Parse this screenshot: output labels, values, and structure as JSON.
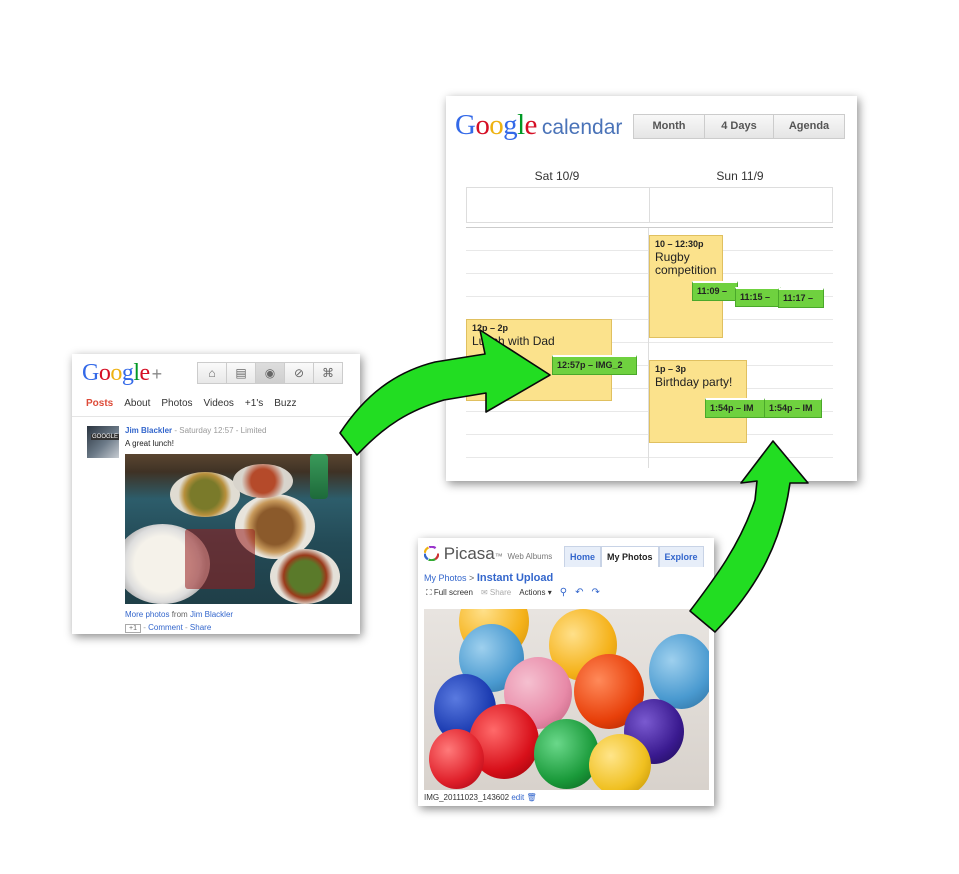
{
  "gplus": {
    "logo_google": "Google",
    "logo_plus": "+",
    "icons": [
      "home-icon",
      "stream-icon",
      "profile-icon",
      "circles-icon",
      "games-icon"
    ],
    "tabs": [
      "Posts",
      "About",
      "Photos",
      "Videos",
      "+1's",
      "Buzz"
    ],
    "avatar_text": "GOOGLE",
    "post_author": "Jim Blackler",
    "post_time": "Saturday 12:57",
    "post_visibility": "Limited",
    "post_text": "A great lunch!",
    "more_prefix": "More photos",
    "more_from": "from",
    "more_author": "Jim Blackler",
    "plus_one": "+1",
    "comment": "Comment",
    "share": "Share"
  },
  "calendar": {
    "logo_google": "Google",
    "logo_calendar": "calendar",
    "views": [
      "Month",
      "4 Days",
      "Agenda"
    ],
    "days": [
      "Sat 10/9",
      "Sun 11/9"
    ],
    "events": [
      {
        "time": "12p – 2p",
        "title": "Lunch with Dad"
      },
      {
        "time": "10 – 12:30p",
        "title": "Rugby competition"
      },
      {
        "time": "1p – 3p",
        "title": "Birthday party!"
      }
    ],
    "photo_events": [
      "12:57p – IMG_2",
      "11:09 –",
      "11:15 –",
      "11:17 –",
      "1:54p – IM",
      "1:54p – IM"
    ]
  },
  "picasa": {
    "logo": "Picasa",
    "logo_tm": "™",
    "logo_sub": "Web Albums",
    "tabs": [
      "Home",
      "My Photos",
      "Explore"
    ],
    "breadcrumb_parent": "My Photos",
    "breadcrumb_sep": ">",
    "breadcrumb_current": "Instant Upload",
    "toolbar": {
      "fullscreen": "Full screen",
      "share": "Share",
      "actions": "Actions"
    },
    "caption": "IMG_20111023_143602",
    "caption_edit": "edit"
  },
  "colors": {
    "google_blue": "#3366cc",
    "posts_red": "#dd4b39",
    "event_yellow": "#fbe28c",
    "photo_green": "#6fd13f",
    "arrow_green": "#22dd22"
  }
}
